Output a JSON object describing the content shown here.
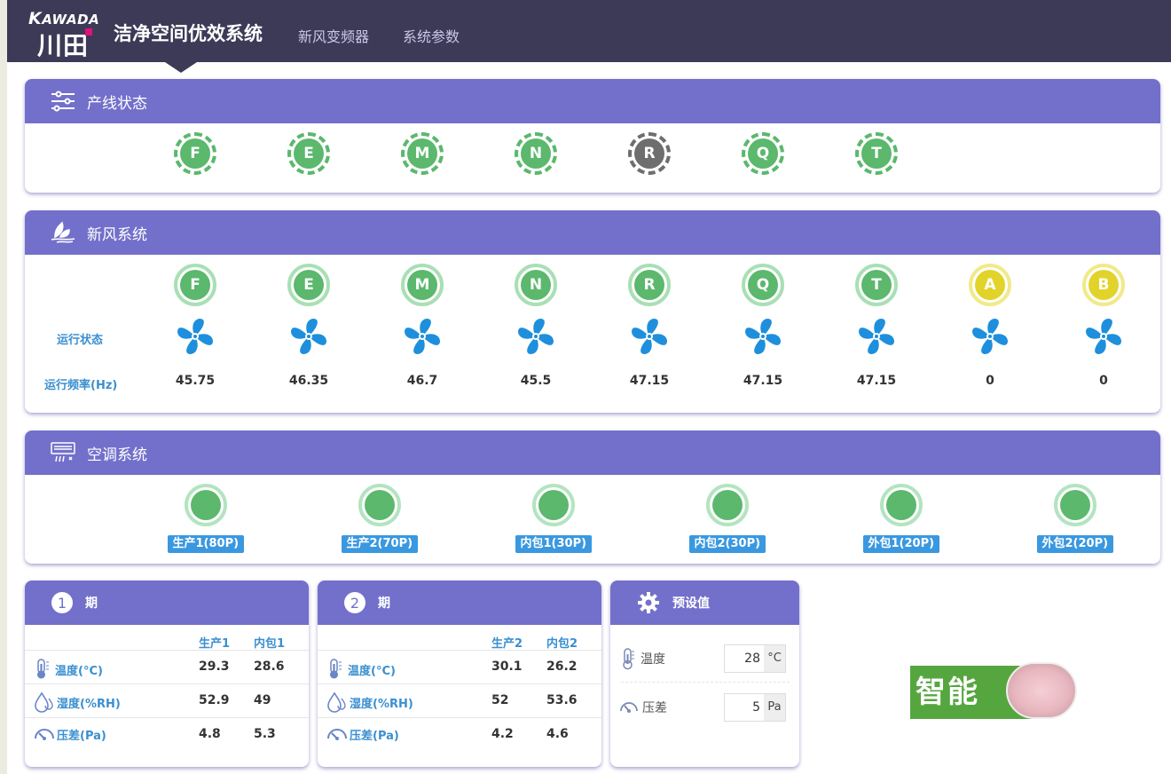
{
  "brand": {
    "latin": "KAWADA",
    "cn": "川田"
  },
  "app_title": "洁净空间优效系统",
  "nav": [
    "新风变频器",
    "系统参数"
  ],
  "line_status": {
    "title": "产线状态",
    "items": [
      {
        "letter": "F",
        "color": "#5bb86d"
      },
      {
        "letter": "E",
        "color": "#5bb86d"
      },
      {
        "letter": "M",
        "color": "#5bb86d"
      },
      {
        "letter": "N",
        "color": "#5bb86d"
      },
      {
        "letter": "R",
        "color": "#6e6e6e"
      },
      {
        "letter": "Q",
        "color": "#5bb86d"
      },
      {
        "letter": "T",
        "color": "#5bb86d"
      }
    ]
  },
  "fresh_air": {
    "title": "新风系统",
    "run_state_label": "运行状态",
    "freq_label": "运行频率(Hz)",
    "units": [
      {
        "letter": "F",
        "freq": "45.75",
        "color": "#5bb86d",
        "ring": "#a9dfb4"
      },
      {
        "letter": "E",
        "freq": "46.35",
        "color": "#5bb86d",
        "ring": "#a9dfb4"
      },
      {
        "letter": "M",
        "freq": "46.7",
        "color": "#5bb86d",
        "ring": "#a9dfb4"
      },
      {
        "letter": "N",
        "freq": "45.5",
        "color": "#5bb86d",
        "ring": "#a9dfb4"
      },
      {
        "letter": "R",
        "freq": "47.15",
        "color": "#5bb86d",
        "ring": "#a9dfb4"
      },
      {
        "letter": "Q",
        "freq": "47.15",
        "color": "#5bb86d",
        "ring": "#a9dfb4"
      },
      {
        "letter": "T",
        "freq": "47.15",
        "color": "#5bb86d",
        "ring": "#a9dfb4"
      },
      {
        "letter": "A",
        "freq": "0",
        "color": "#e2d32a",
        "ring": "#f2e98a"
      },
      {
        "letter": "B",
        "freq": "0",
        "color": "#e2d32a",
        "ring": "#f2e98a"
      }
    ],
    "fan_color": "#1e8fdc"
  },
  "ac": {
    "title": "空调系统",
    "units": [
      "生产1(80P)",
      "生产2(70P)",
      "内包1(30P)",
      "内包2(30P)",
      "外包1(20P)",
      "外包2(20P)"
    ]
  },
  "phase1": {
    "num": "1",
    "title": "期",
    "cols": [
      "生产1",
      "内包1"
    ],
    "rows": [
      {
        "label": "温度(°C)",
        "icon": "thermometer-icon",
        "values": [
          "29.3",
          "28.6"
        ]
      },
      {
        "label": "湿度(%RH)",
        "icon": "droplet-icon",
        "values": [
          "52.9",
          "49"
        ]
      },
      {
        "label": "压差(Pa)",
        "icon": "gauge-icon",
        "values": [
          "4.8",
          "5.3"
        ]
      }
    ]
  },
  "phase2": {
    "num": "2",
    "title": "期",
    "cols": [
      "生产2",
      "内包2"
    ],
    "rows": [
      {
        "label": "温度(°C)",
        "icon": "thermometer-icon",
        "values": [
          "30.1",
          "26.2"
        ]
      },
      {
        "label": "湿度(%RH)",
        "icon": "droplet-icon",
        "values": [
          "52",
          "53.6"
        ]
      },
      {
        "label": "压差(Pa)",
        "icon": "gauge-icon",
        "values": [
          "4.2",
          "4.6"
        ]
      }
    ]
  },
  "preset": {
    "title": "预设值",
    "temp": {
      "label": "温度",
      "value": "28",
      "unit": "°C"
    },
    "pressure": {
      "label": "压差",
      "value": "5",
      "unit": "Pa"
    }
  },
  "smart_button": {
    "label": "智能",
    "state": "off"
  },
  "colors": {
    "header_purple": "#7370cb",
    "topbar": "#3d3a57",
    "label_blue": "#3a8fd0"
  }
}
